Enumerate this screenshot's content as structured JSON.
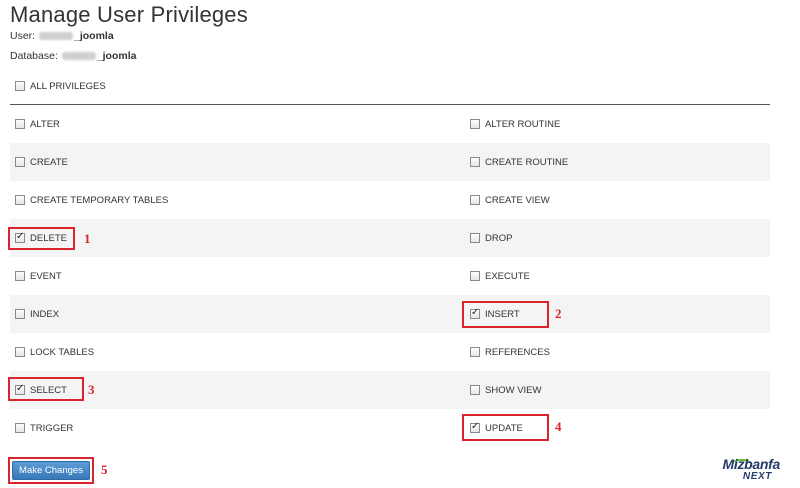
{
  "page": {
    "title": "Manage User Privileges",
    "user_label": "User:",
    "user_value_suffix": "_joomla",
    "database_label": "Database:",
    "database_value_suffix": "_joomla"
  },
  "all_privileges": {
    "label": "ALL PRIVILEGES",
    "checked": false
  },
  "privileges": {
    "rows": [
      {
        "left": {
          "label": "ALTER",
          "checked": false
        },
        "right": {
          "label": "ALTER ROUTINE",
          "checked": false
        }
      },
      {
        "left": {
          "label": "CREATE",
          "checked": false
        },
        "right": {
          "label": "CREATE ROUTINE",
          "checked": false
        }
      },
      {
        "left": {
          "label": "CREATE TEMPORARY TABLES",
          "checked": false
        },
        "right": {
          "label": "CREATE VIEW",
          "checked": false
        }
      },
      {
        "left": {
          "label": "DELETE",
          "checked": true
        },
        "right": {
          "label": "DROP",
          "checked": false
        }
      },
      {
        "left": {
          "label": "EVENT",
          "checked": false
        },
        "right": {
          "label": "EXECUTE",
          "checked": false
        }
      },
      {
        "left": {
          "label": "INDEX",
          "checked": false
        },
        "right": {
          "label": "INSERT",
          "checked": true
        }
      },
      {
        "left": {
          "label": "LOCK TABLES",
          "checked": false
        },
        "right": {
          "label": "REFERENCES",
          "checked": false
        }
      },
      {
        "left": {
          "label": "SELECT",
          "checked": true
        },
        "right": {
          "label": "SHOW VIEW",
          "checked": false
        }
      },
      {
        "left": {
          "label": "TRIGGER",
          "checked": false
        },
        "right": {
          "label": "UPDATE",
          "checked": true
        }
      }
    ]
  },
  "annotations": {
    "n1": "1",
    "n2": "2",
    "n3": "3",
    "n4": "4",
    "n5": "5"
  },
  "actions": {
    "submit_label": "Make Changes"
  },
  "watermark": {
    "line1": "Mizbanfa",
    "line2": "NEXT"
  },
  "colors": {
    "highlight": "#d9232d",
    "button": "#3a79b8",
    "logo": "#233a6b"
  }
}
